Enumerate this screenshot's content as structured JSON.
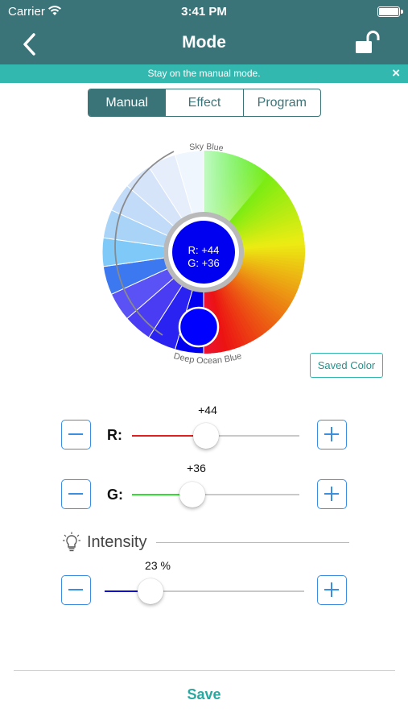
{
  "status_bar": {
    "carrier": "Carrier",
    "time": "3:41 PM"
  },
  "nav": {
    "title": "Mode",
    "back_icon": "chevron-left-icon",
    "lock_icon": "unlocked-padlock-icon"
  },
  "banner": {
    "text": "Stay on the manual mode.",
    "close_label": "×"
  },
  "tabs": [
    {
      "label": "Manual",
      "active": true
    },
    {
      "label": "Effect",
      "active": false
    },
    {
      "label": "Program",
      "active": false
    }
  ],
  "color_wheel": {
    "top_label": "Sky Blue",
    "bottom_label": "Deep Ocean Blue",
    "center_r": "R: +44",
    "center_g": "G: +36",
    "center_color": "#0000f0"
  },
  "saved_color_label": "Saved Color",
  "sliders": {
    "r": {
      "label": "R:",
      "value": "+44",
      "fraction": 0.44,
      "fill_color": "#e02020"
    },
    "g": {
      "label": "G:",
      "value": "+36",
      "fraction": 0.36,
      "fill_color": "#33dd33"
    },
    "intensity": {
      "label": "Intensity",
      "value": "23 %",
      "fraction": 0.23,
      "fill_color": "#1010c8"
    }
  },
  "save_label": "Save",
  "colors": {
    "nav_bg": "#3a7479",
    "banner_bg": "#33b8b0",
    "accent_blue": "#3b8fe0",
    "save_teal": "#2aa8a0"
  }
}
